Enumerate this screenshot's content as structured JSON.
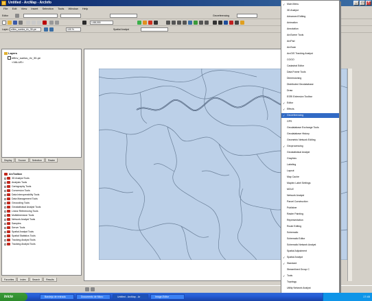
{
  "window": {
    "title": "Untitled - ArcMap - ArcInfo",
    "minimize_label": "_",
    "maximize_label": "□",
    "close_label": "×"
  },
  "menubar": [
    "File",
    "Edit",
    "View",
    "Insert",
    "Selection",
    "Tools",
    "Window",
    "Help"
  ],
  "toolbar": {
    "editor_label": "Editor",
    "scale_value": "1:88,000",
    "spatial_analyst_label": "Spatial Analyst",
    "layer_label": "Layer:",
    "layer_value": "elfinv_suelos_rlv_30-pe",
    "tool_value": "100 %",
    "georef_label": "Georeferencing"
  },
  "toc": {
    "root": "Layers",
    "layer": "elfinv_suelos_rlv_30-pe",
    "legend": "<VALUE>"
  },
  "toc_tabs": [
    "Display",
    "Source",
    "Selection",
    "Raster"
  ],
  "toolbox": {
    "title": "ArcToolbox",
    "items": [
      "3D Analyst Tools",
      "Analysis Tools",
      "Cartography Tools",
      "Conversion Tools",
      "Data Interoperability Tools",
      "Data Management Tools",
      "Geocoding Tools",
      "Geostatistical Analyst Tools",
      "Linear Referencing Tools",
      "Multidimension Tools",
      "Network Analyst Tools",
      "Samples",
      "Server Tools",
      "Spatial Analyst Tools",
      "Spatial Statistics Tools",
      "Tracking Analyst Tools",
      "Tracking Analyst Tools"
    ]
  },
  "toolbox_tabs": [
    "Favorites",
    "Index",
    "Search",
    "Results"
  ],
  "dropdown": {
    "items": [
      {
        "label": "Main Menu",
        "checked": true
      },
      {
        "label": "3D Analyst",
        "checked": false
      },
      {
        "label": "Advanced Editing",
        "checked": false
      },
      {
        "label": "Animation",
        "checked": false
      },
      {
        "label": "Annotation",
        "checked": false
      },
      {
        "label": "ArcScene Tools",
        "checked": false
      },
      {
        "label": "ArcPad",
        "checked": false
      },
      {
        "label": "ArcScan",
        "checked": false
      },
      {
        "label": "ArcGIS Tracking Analyst",
        "checked": false
      },
      {
        "label": "COGO",
        "checked": false
      },
      {
        "label": "Cadastral Editor",
        "checked": false
      },
      {
        "label": "Data Frame Tools",
        "checked": false
      },
      {
        "label": "Dimensioning",
        "checked": false
      },
      {
        "label": "Distributed Geodatabase",
        "checked": false
      },
      {
        "label": "Draw",
        "checked": false
      },
      {
        "label": "ESRI Extension Toolbar",
        "checked": false
      },
      {
        "label": "Editor",
        "checked": true
      },
      {
        "label": "Effects",
        "checked": true
      },
      {
        "label": "Georeferencing",
        "checked": true,
        "selected": true
      },
      {
        "label": "GPS",
        "checked": false
      },
      {
        "label": "Geodatabase Exchange Tools",
        "checked": false
      },
      {
        "label": "Geodatabase History",
        "checked": false
      },
      {
        "label": "Geometric Network Editing",
        "checked": false
      },
      {
        "label": "Geoprocessing",
        "checked": true
      },
      {
        "label": "Geostatistical Analyst",
        "checked": false
      },
      {
        "label": "Graphics",
        "checked": false
      },
      {
        "label": "Labeling",
        "checked": false
      },
      {
        "label": "Layout",
        "checked": false
      },
      {
        "label": "Map Cache",
        "checked": false
      },
      {
        "label": "Maplex Label Settings",
        "checked": false
      },
      {
        "label": "MOLE",
        "checked": false
      },
      {
        "label": "Network Analyst",
        "checked": false
      },
      {
        "label": "Parcel Construction",
        "checked": false
      },
      {
        "label": "Publisher",
        "checked": false
      },
      {
        "label": "Raster Painting",
        "checked": false
      },
      {
        "label": "Representation",
        "checked": false
      },
      {
        "label": "Route Editing",
        "checked": false
      },
      {
        "label": "Schematic",
        "checked": false
      },
      {
        "label": "Schematic Editor",
        "checked": false
      },
      {
        "label": "Schematic Network Analyst",
        "checked": false
      },
      {
        "label": "Spatial Adjustment",
        "checked": false
      },
      {
        "label": "Spatial Analyst",
        "checked": true
      },
      {
        "label": "Standard",
        "checked": true
      },
      {
        "label": "Streamlined Group C",
        "checked": false
      },
      {
        "label": "Tools",
        "checked": true
      },
      {
        "label": "Topology",
        "checked": false
      },
      {
        "label": "Utility Network Analyst",
        "checked": false
      }
    ]
  },
  "taskbar": {
    "start_label": "Inicio",
    "tasks": [
      "Bandeja de entrada",
      "Documento de Micro",
      "Untitled - ArcMap - Ar",
      "Image-Editor"
    ],
    "clock": "17:45"
  },
  "colors": {
    "map_fill": "#bcd0e8",
    "map_line": "#6a7f98",
    "river": "#3a4c66",
    "menu_highlight": "#316ac5"
  }
}
